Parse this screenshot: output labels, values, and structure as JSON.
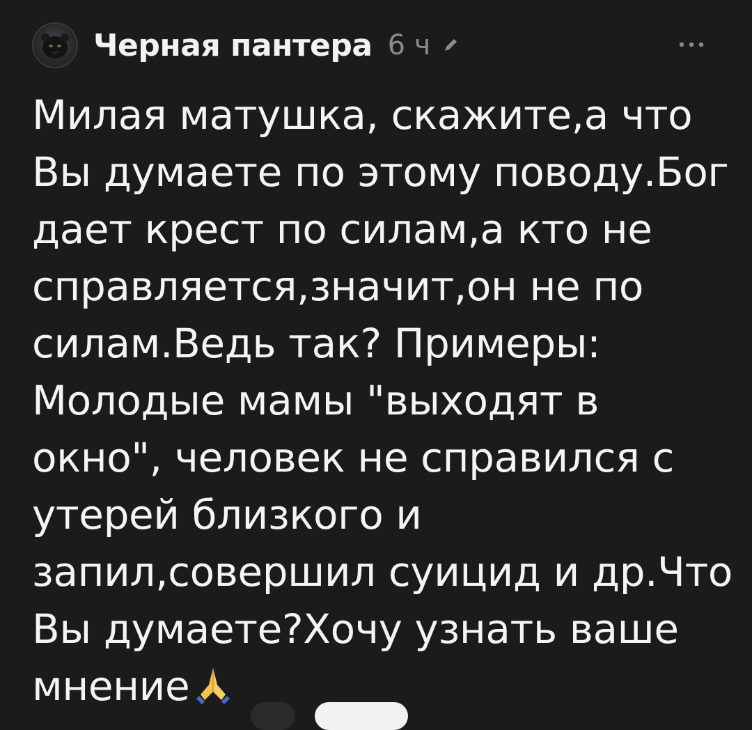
{
  "post": {
    "author": "Черная пантера",
    "time": "6 ч",
    "avatar_icon": "panther-avatar",
    "edit_icon": "pencil-icon",
    "more_icon": "ellipsis-icon",
    "lines": [
      "Милая матушка, скажите,а что",
      "Вы думаете по этому поводу.Бог",
      "дает крест по силам,а кто не",
      "справляется,значит,он не по",
      "силам.Ведь так? Примеры:",
      "Молодые мамы \"выходят в",
      "окно\", человек не справился с",
      "утерей близкого и",
      "запил,совершил суицид и др.Что",
      "Вы думаете?Хочу узнать ваше",
      "мнение"
    ],
    "emoji": "🙏"
  },
  "colors": {
    "background": "#1b1b1c",
    "text": "#f4f4f4",
    "muted": "#8a8a8a"
  }
}
